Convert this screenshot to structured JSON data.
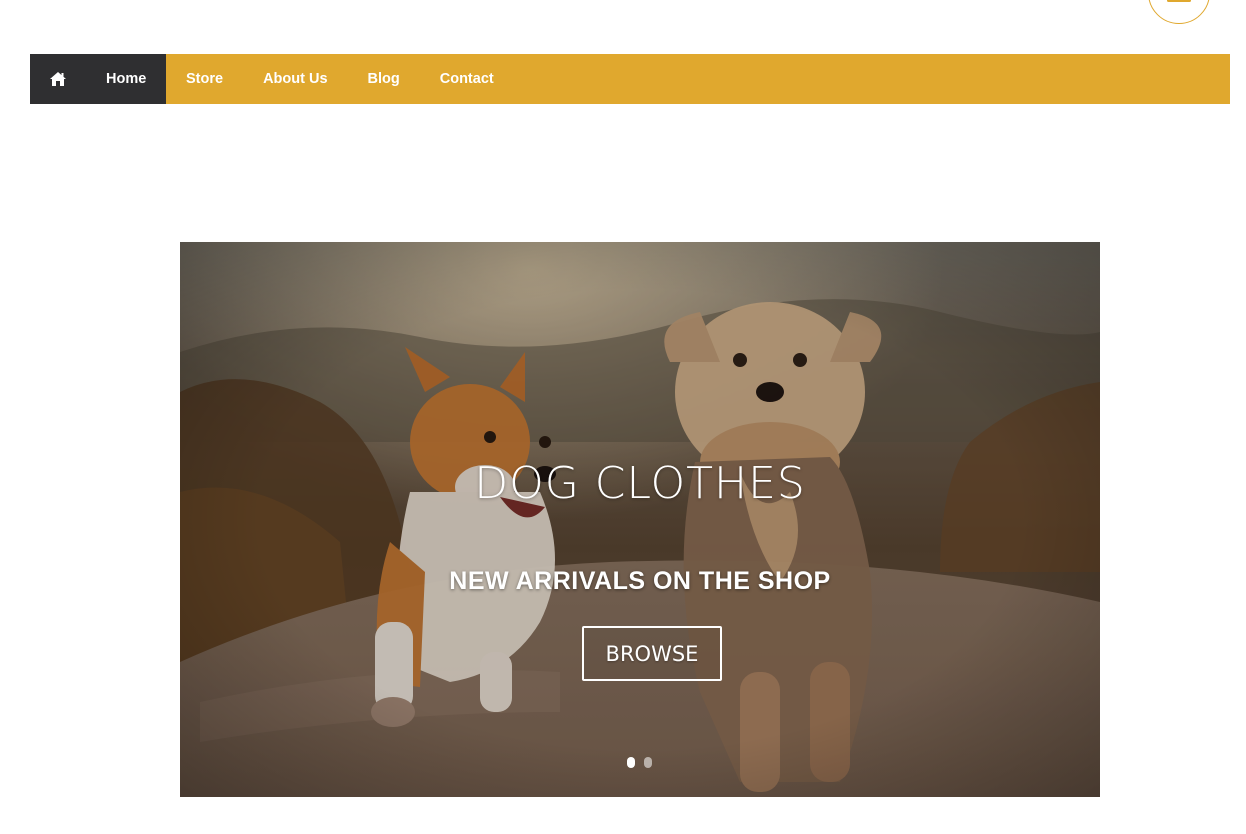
{
  "header": {
    "menu_toggle_icon": "hamburger-menu-icon"
  },
  "nav": {
    "home_icon": "home-icon",
    "items": [
      {
        "label": "Home",
        "active": true
      },
      {
        "label": "Store"
      },
      {
        "label": "About Us"
      },
      {
        "label": "Blog"
      },
      {
        "label": "Contact"
      }
    ]
  },
  "hero": {
    "title": "DOG CLOTHES",
    "subtitle": "NEW ARRIVALS ON THE SHOP",
    "button_label": "BROWSE",
    "slides": 2,
    "active_slide": 1
  },
  "colors": {
    "accent": "#e0a82e",
    "nav_active_bg": "#2f2f31",
    "text_on_dark": "#ffffff"
  }
}
